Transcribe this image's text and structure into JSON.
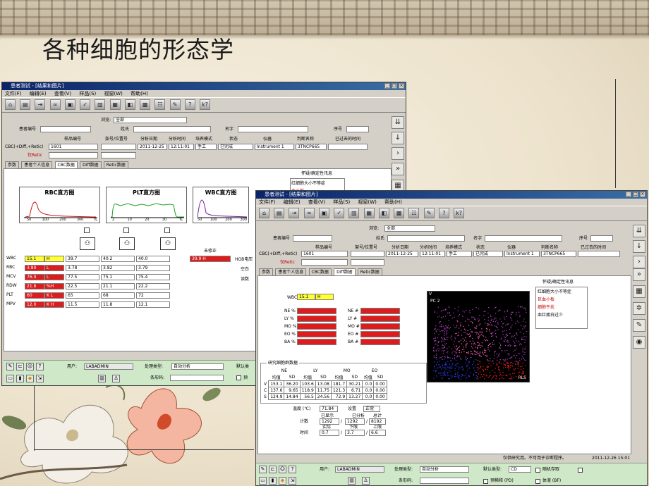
{
  "slide": {
    "title": "各种细胞的形态学"
  },
  "back_window": {
    "title": "患者测试 - [结果和图片]",
    "menu": [
      "文件(F)",
      "编辑(E)",
      "查看(V)",
      "样品(S)",
      "视窗(W)",
      "帮助(H)"
    ],
    "browse_label": "浏览:",
    "browse_value": "全部",
    "patient_no_label": "患者编号",
    "last_name_label": "姓氏",
    "first_name_label": "名字",
    "seq_label": "序号",
    "headers": [
      "样品编号",
      "架号/位置号",
      "分析日期",
      "分析时间",
      "培养模式",
      "状态",
      "仪器",
      "判断名称",
      "已过去的时间"
    ],
    "row_labels": [
      "CBC(+Diff,+Retic)",
      "仅Retic"
    ],
    "row_values": [
      "1601",
      "",
      "2011-12-25",
      "12:11:01",
      "手工",
      "已完成",
      "Instrument 1",
      "3TNCP665",
      ""
    ],
    "tabs": [
      "参数",
      "患者个人信息",
      "CBC数据",
      "Diff数据",
      "Retic数据"
    ],
    "flag_label": "怀疑/确定性讯息",
    "flag_items": [
      "红细胞大小不等症",
      "血小板"
    ],
    "histograms": [
      {
        "title": "RBC直方图",
        "ticks": [
          "50",
          "100",
          "200",
          "300",
          "fL"
        ]
      },
      {
        "title": "PLT直方图",
        "ticks": [
          "2",
          "10",
          "20",
          "30",
          "fL"
        ]
      },
      {
        "title": "WBC直方图",
        "ticks": [
          "50",
          "100",
          "200",
          "300"
        ]
      }
    ],
    "uncorrected_label": "未修正",
    "extra_labels": [
      "HGB电压",
      "空白",
      "读数"
    ],
    "params": [
      {
        "name": "WBC",
        "value": "15.1",
        "flag": "H",
        "c1": "39.7",
        "c2": "40.2",
        "c3": "40.0"
      },
      {
        "name": "RBC",
        "value": "3.80",
        "flag": "L",
        "c1": "3.78",
        "c2": "3.82",
        "c3": "3.79"
      },
      {
        "name": "MCV",
        "value": "76.0",
        "flag": "L",
        "c1": "77.5",
        "c2": "75.1",
        "c3": "75.4"
      },
      {
        "name": "RDW",
        "value": "21.8",
        "flag": "%H",
        "c1": "22.5",
        "c2": "21.1",
        "c3": "22.2"
      },
      {
        "name": "PLT",
        "value": "60",
        "flag": "K L",
        "c1": "65",
        "c2": "68",
        "c3": "72"
      },
      {
        "name": "MPV",
        "value": "12.0",
        "flag": "K H",
        "c1": "11.5",
        "c2": "11.8",
        "c3": "12.1"
      }
    ],
    "uncorrected_value": "39.9  H",
    "bottom": {
      "user_label": "用户:",
      "user_value": "LABADMIN",
      "process_label": "处理类型:",
      "process_value": "自动分析",
      "default_type_label": "默认类",
      "barcode_label": "条形码:",
      "pre_label": "预"
    }
  },
  "front_window": {
    "title": "患者测试 - [结果和图片]",
    "menu": [
      "文件(F)",
      "编辑(E)",
      "查看(V)",
      "样品(S)",
      "视窗(W)",
      "帮助(H)"
    ],
    "browse_label": "浏览:",
    "browse_value": "全部",
    "patient_no_label": "患者编号",
    "last_name_label": "姓氏",
    "first_name_label": "名字",
    "seq_label": "序号",
    "headers": [
      "样品编号",
      "架号/位置号",
      "分析日期",
      "分析时间",
      "培养模式",
      "状态",
      "仪器",
      "判断名称",
      "已过去的时间"
    ],
    "row_labels": [
      "CBC(+Diff,+Retic)",
      "仅Retic"
    ],
    "row_values": [
      "1601",
      "",
      "2011-12-25",
      "12:11:01",
      "手工",
      "已完成",
      "Instrument 1",
      "3TNCP665",
      ""
    ],
    "tabs": [
      "参数",
      "患者个人信息",
      "CBC数据",
      "Diff数据",
      "Retic数据"
    ],
    "flag_label": "怀疑/确定性讯息",
    "flag_items": [
      "红细胞大小不等症",
      "巨血小板",
      "细胞干扰",
      "血红蛋白过少"
    ],
    "wbc": {
      "label": "WBC",
      "value": "15.1",
      "flag": "H"
    },
    "diff_pct": [
      "NE %",
      "LY %",
      "MO %",
      "EO %",
      "BA %"
    ],
    "diff_abs": [
      "NE #",
      "LY #",
      "MO #",
      "EO #",
      "BA #"
    ],
    "scatter_labels": {
      "top": "V",
      "pc": "PC 2",
      "corner": "RLS"
    },
    "research": {
      "title": "研究细胞群数据",
      "groups": [
        "NE",
        "LY",
        "MO",
        "EO"
      ],
      "subheads": [
        "均值",
        "SD"
      ],
      "rows": [
        {
          "label": "V",
          "vals": [
            "153.1",
            "36.20",
            "103.6",
            "13.08",
            "181.7",
            "30.21",
            "0.0",
            "0.00"
          ]
        },
        {
          "label": "C",
          "vals": [
            "137.6",
            "9.65",
            "118.9",
            "11.75",
            "121.3",
            "6.71",
            "0.0",
            "0.00"
          ]
        },
        {
          "label": "S",
          "vals": [
            "124.9",
            "14.84",
            "56.5",
            "24.56",
            "72.9",
            "13.27",
            "0.0",
            "0.00"
          ]
        }
      ]
    },
    "temp": {
      "label": "温度 (℃)",
      "value": "71.84",
      "set_label": "设置",
      "set_value": "正常"
    },
    "count_labels": {
      "displayed": "已显示",
      "analyzed": "已分析",
      "total": "总计",
      "count": "计数",
      "actual": "实际",
      "lower": "下限",
      "upper": "上限",
      "time": "时间"
    },
    "count_values": {
      "displayed": "1292",
      "analyzed": "1292",
      "total": "8192",
      "actual": "0.7",
      "lower": "3.7",
      "upper": "6.6"
    },
    "status_text": "仅供研究用。不可用于诊断程序。",
    "status_datetime": "2011-12-26 15:01",
    "bottom": {
      "user_label": "用户:",
      "user_value": "LABADMIN",
      "process_label": "处理类型:",
      "process_value": "自动分析",
      "default_type_label": "默认类型:",
      "default_type_value": "CD",
      "random_label": "随机存取",
      "barcode_label": "条形码:",
      "pre_label": "预稀释 (PD)",
      "body_label": "体液 (BF)"
    }
  }
}
